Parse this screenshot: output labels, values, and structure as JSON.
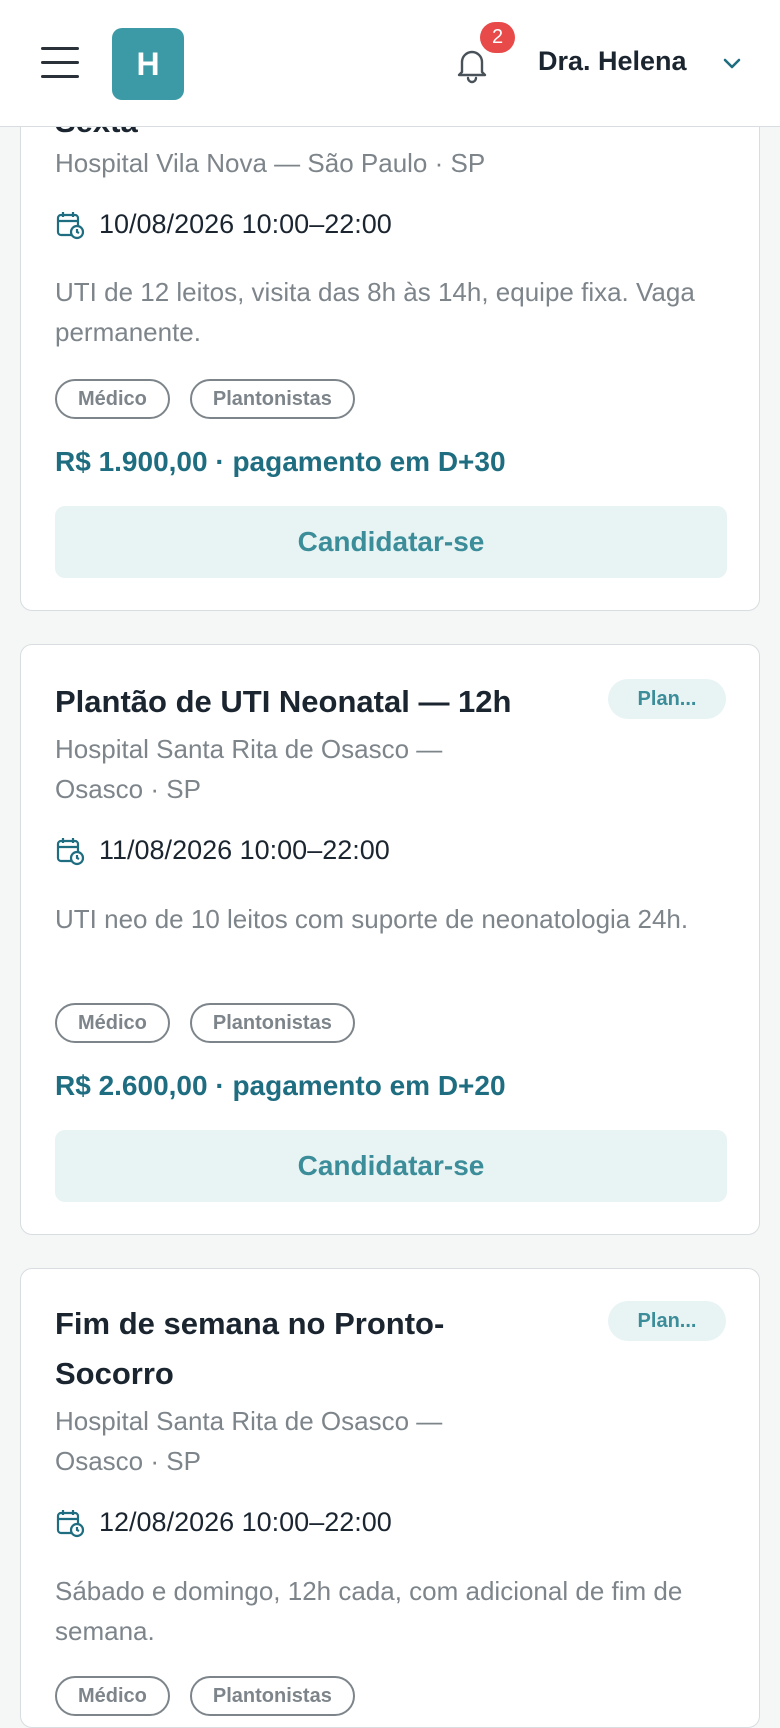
{
  "header": {
    "logo_letter": "H",
    "notification_count": "2",
    "user_name": "Dra. Helena"
  },
  "cards": [
    {
      "title": "Sexta",
      "hospital": "Hospital Vila Nova — São Paulo · SP",
      "date": "10/08/2026 10:00–22:00",
      "description": "UTI de 12 leitos, visita das 8h às 14h, equipe fixa. Vaga permanente.",
      "chips": [
        "Médico",
        "Plantonistas"
      ],
      "price": "R$ 1.900,00 · pagamento em D+30",
      "apply_label": "Candidatar-se"
    },
    {
      "title": "Plantão de UTI Neonatal — 12h",
      "tag": "Plan...",
      "hospital": "Hospital Santa Rita de Osasco — Osasco · SP",
      "date": "11/08/2026 10:00–22:00",
      "description": "UTI neo de 10 leitos com suporte de neonatologia 24h.",
      "chips": [
        "Médico",
        "Plantonistas"
      ],
      "price": "R$ 2.600,00 · pagamento em D+20",
      "apply_label": "Candidatar-se"
    },
    {
      "title": "Fim de semana no Pronto-Socorro",
      "tag": "Plan...",
      "hospital": "Hospital Santa Rita de Osasco — Osasco · SP",
      "date": "12/08/2026 10:00–22:00",
      "description": "Sábado e domingo, 12h cada, com adicional de fim de semana.",
      "chips": [
        "Médico",
        "Plantonistas"
      ]
    }
  ]
}
